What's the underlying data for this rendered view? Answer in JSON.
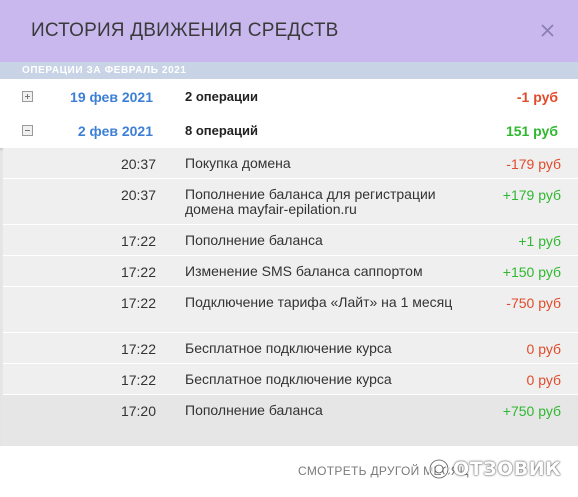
{
  "header": {
    "title": "ИСТОРИЯ ДВИЖЕНИЯ СРЕДСТВ",
    "close_icon": "close-icon"
  },
  "period": {
    "label": "ОПЕРАЦИИ ЗА ФЕВРАЛЬ 2021"
  },
  "days": [
    {
      "date": "19 фев 2021",
      "count": "2 операции",
      "sum": "-1 руб",
      "expanded": false,
      "sum_color": "#e14b2a"
    },
    {
      "date": "2 фев 2021",
      "count": "8 операций",
      "sum": "151 руб",
      "expanded": true,
      "sum_color": "#2fb82f"
    }
  ],
  "operations": [
    {
      "time": "20:37",
      "desc": "Покупка домена",
      "amount": "-179 руб"
    },
    {
      "time": "20:37",
      "desc": "Пополнение баланса для регистрации домена mayfair-epilation.ru",
      "amount": "+179 руб"
    },
    {
      "time": "17:22",
      "desc": "Пополнение баланса",
      "amount": "+1 руб"
    },
    {
      "time": "17:22",
      "desc": "Изменение SMS баланса саппортом",
      "amount": "+150 руб"
    },
    {
      "time": "17:22",
      "desc": "Подключение тарифа «Лайт» на 1 месяц",
      "amount": "-750 руб"
    },
    {
      "time": "17:22",
      "desc": "Бесплатное подключение курса",
      "amount": "0 руб"
    },
    {
      "time": "17:22",
      "desc": "Бесплатное подключение курса",
      "amount": "0 руб"
    },
    {
      "time": "17:20",
      "desc": "Пополнение баланса",
      "amount": "+750 руб"
    }
  ],
  "footer": {
    "link": "СМОТРЕТЬ ДРУГОЙ МЕСЯЦ"
  },
  "watermark": {
    "text": "ОТЗОВИК"
  },
  "colors": {
    "header_bg": "#c8b8ee",
    "period_bg": "#c9d3e6",
    "date_blue": "#3d7fd6",
    "negative": "#e14b2a",
    "positive": "#2fb82f"
  }
}
